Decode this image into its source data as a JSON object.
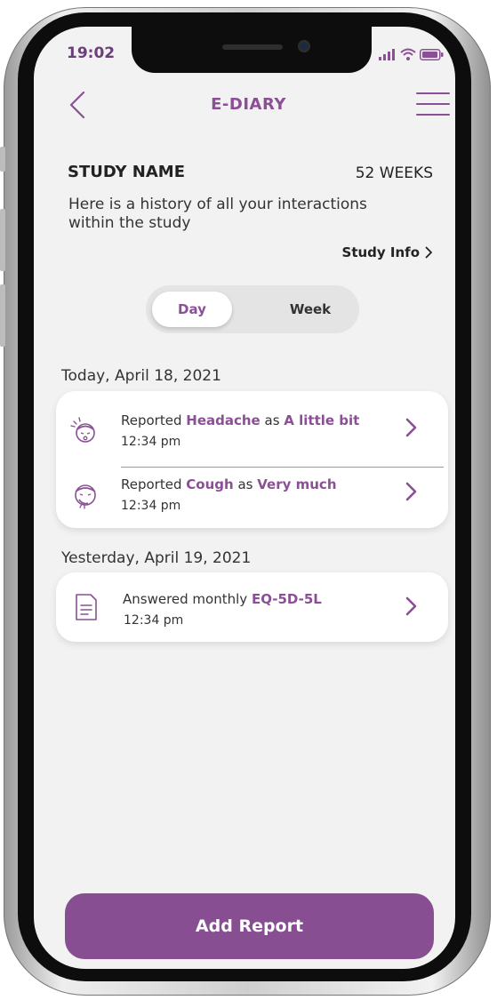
{
  "status_bar": {
    "time": "19:02"
  },
  "nav": {
    "title": "E-DIARY"
  },
  "study": {
    "name": "STUDY NAME",
    "duration": "52 WEEKS",
    "description": "Here is a history of all your interactions within the study",
    "info_link": "Study Info"
  },
  "toggle": {
    "day_label": "Day",
    "week_label": "Week",
    "selected": "Day"
  },
  "groups": [
    {
      "heading": "Today, April 18, 2021",
      "entries": [
        {
          "icon": "headache-face-icon",
          "verb": "Reported",
          "item": "Headache",
          "connector": "as",
          "value": "A little bit",
          "time": "12:34 pm"
        },
        {
          "icon": "cough-face-icon",
          "verb": "Reported",
          "item": "Cough",
          "connector": "as",
          "value": "Very much",
          "time": "12:34 pm"
        }
      ]
    },
    {
      "heading": "Yesterday, April 19, 2021",
      "entries": [
        {
          "icon": "document-icon",
          "verb": "Answered monthly",
          "item": "EQ-5D-5L",
          "time": "12:34 pm"
        }
      ]
    }
  ],
  "footer": {
    "add_report_label": "Add Report"
  },
  "colors": {
    "accent": "#8a4f95",
    "button": "#874f91",
    "screen_bg": "#f2f2f2"
  }
}
